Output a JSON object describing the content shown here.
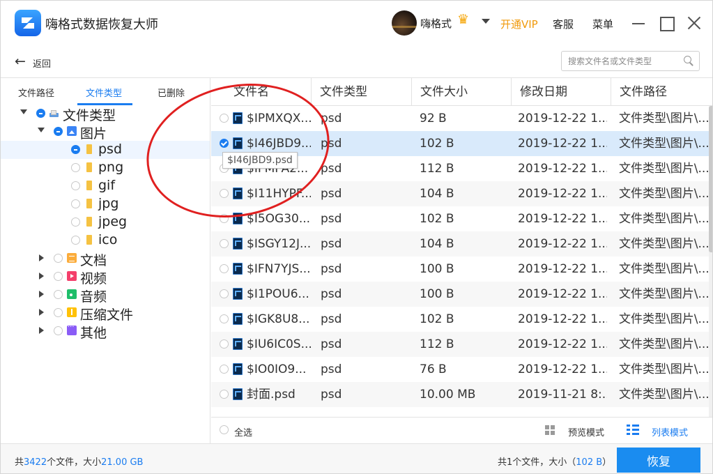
{
  "app": {
    "title": "嗨格式数据恢复大师",
    "username": "嗨格式",
    "vip_label": "开通VIP",
    "service_label": "客服",
    "menu_label": "菜单"
  },
  "nav": {
    "back_label": "返回",
    "search_placeholder": "搜索文件名或文件类型"
  },
  "left_tabs": [
    "文件路径",
    "文件类型",
    "已删除"
  ],
  "tree": {
    "root": "文件类型",
    "pictures": "图片",
    "formats": [
      "psd",
      "png",
      "gif",
      "jpg",
      "jpeg",
      "ico"
    ],
    "others": [
      "文档",
      "视频",
      "音频",
      "压缩文件",
      "其他"
    ]
  },
  "table": {
    "columns": [
      "文件名",
      "文件类型",
      "文件大小",
      "修改日期",
      "文件路径"
    ],
    "rows": [
      {
        "name": "$IPMXQX...",
        "type": "psd",
        "size": "92 B",
        "date": "2019-12-22 1...",
        "path": "文件类型\\图片\\..."
      },
      {
        "name": "$I46JBD9...",
        "type": "psd",
        "size": "102 B",
        "date": "2019-12-22 1...",
        "path": "文件类型\\图片\\..."
      },
      {
        "name": "$IFMPA2...",
        "type": "psd",
        "size": "112 B",
        "date": "2019-12-22 1...",
        "path": "文件类型\\图片\\..."
      },
      {
        "name": "$I11HYPF...",
        "type": "psd",
        "size": "104 B",
        "date": "2019-12-22 1...",
        "path": "文件类型\\图片\\..."
      },
      {
        "name": "$I5OG30...",
        "type": "psd",
        "size": "102 B",
        "date": "2019-12-22 1...",
        "path": "文件类型\\图片\\..."
      },
      {
        "name": "$ISGY12J...",
        "type": "psd",
        "size": "104 B",
        "date": "2019-12-22 1...",
        "path": "文件类型\\图片\\..."
      },
      {
        "name": "$IFN7YJS...",
        "type": "psd",
        "size": "100 B",
        "date": "2019-12-22 1...",
        "path": "文件类型\\图片\\..."
      },
      {
        "name": "$I1POU6...",
        "type": "psd",
        "size": "100 B",
        "date": "2019-12-22 1...",
        "path": "文件类型\\图片\\..."
      },
      {
        "name": "$IGK8U8...",
        "type": "psd",
        "size": "102 B",
        "date": "2019-12-22 1...",
        "path": "文件类型\\图片\\..."
      },
      {
        "name": "$IU6IC0S...",
        "type": "psd",
        "size": "112 B",
        "date": "2019-12-22 1...",
        "path": "文件类型\\图片\\..."
      },
      {
        "name": "$IO0IO9...",
        "type": "psd",
        "size": "76 B",
        "date": "2019-12-22 1...",
        "path": "文件类型\\图片\\..."
      },
      {
        "name": "封面.psd",
        "type": "psd",
        "size": "10.00 MB",
        "date": "2019-11-21 8:...",
        "path": "文件类型\\图片\\..."
      },
      {
        "name": "",
        "type": "",
        "size": "",
        "date": "",
        "path": ""
      }
    ]
  },
  "tooltip": "$I46JBD9.psd",
  "footer": {
    "select_all": "全选",
    "preview_mode": "预览模式",
    "list_mode": "列表模式"
  },
  "status": {
    "total_prefix": "共",
    "total_count": "3422",
    "total_mid": "个文件，大小",
    "total_size": "21.00 GB",
    "selected_prefix": "共1个文件，大小（",
    "selected_size": "102 B",
    "selected_suffix": "）",
    "recover_label": "恢复"
  },
  "colors": {
    "accent": "#1a7cf0",
    "vip": "#f09a0c",
    "annotation": "#e02020"
  }
}
